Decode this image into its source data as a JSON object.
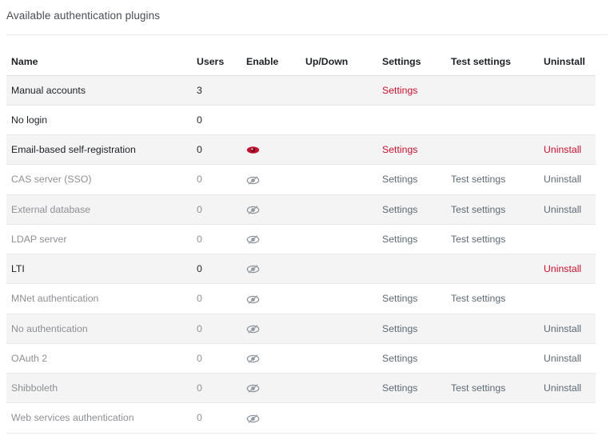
{
  "page": {
    "heading": "Available authentication plugins"
  },
  "table": {
    "columns": [
      {
        "key": "name",
        "label": "Name"
      },
      {
        "key": "users",
        "label": "Users"
      },
      {
        "key": "enable",
        "label": "Enable"
      },
      {
        "key": "updown",
        "label": "Up/Down"
      },
      {
        "key": "settings",
        "label": "Settings"
      },
      {
        "key": "test",
        "label": "Test settings"
      },
      {
        "key": "uninstall",
        "label": "Uninstall"
      }
    ],
    "labels": {
      "settings": "Settings",
      "test_settings": "Test settings",
      "uninstall": "Uninstall"
    },
    "icons": {
      "enabled": "eye-visible-icon",
      "disabled": "eye-slash-hidden-icon"
    },
    "colors": {
      "link_enabled": "#c4122f",
      "link_disabled": "#5d6a74",
      "text_enabled": "#1d2125",
      "text_disabled": "#8e9093",
      "row_shade": "#f4f4f5",
      "row_plain": "#ffffff",
      "eye_enabled": "#c4122f",
      "eye_disabled": "#8a9199"
    },
    "rows": [
      {
        "name": "Manual accounts",
        "users": "3",
        "enabled": true,
        "dim": false,
        "eye": "none",
        "updown": "",
        "settings": "Settings",
        "test": "",
        "uninstall": ""
      },
      {
        "name": "No login",
        "users": "0",
        "enabled": true,
        "dim": false,
        "eye": "none",
        "updown": "",
        "settings": "",
        "test": "",
        "uninstall": ""
      },
      {
        "name": "Email-based self-registration",
        "users": "0",
        "enabled": true,
        "dim": false,
        "eye": "visible",
        "updown": "",
        "settings": "Settings",
        "test": "",
        "uninstall": "Uninstall"
      },
      {
        "name": "CAS server (SSO)",
        "users": "0",
        "enabled": false,
        "dim": true,
        "eye": "hidden",
        "updown": "",
        "settings": "Settings",
        "test": "Test settings",
        "uninstall": "Uninstall"
      },
      {
        "name": "External database",
        "users": "0",
        "enabled": false,
        "dim": true,
        "eye": "hidden",
        "updown": "",
        "settings": "Settings",
        "test": "Test settings",
        "uninstall": "Uninstall"
      },
      {
        "name": "LDAP server",
        "users": "0",
        "enabled": false,
        "dim": true,
        "eye": "hidden",
        "updown": "",
        "settings": "Settings",
        "test": "Test settings",
        "uninstall": ""
      },
      {
        "name": "LTI",
        "users": "0",
        "enabled": false,
        "dim": false,
        "eye": "hidden",
        "updown": "",
        "settings": "",
        "test": "",
        "uninstall": "Uninstall"
      },
      {
        "name": "MNet authentication",
        "users": "0",
        "enabled": false,
        "dim": true,
        "eye": "hidden",
        "updown": "",
        "settings": "Settings",
        "test": "Test settings",
        "uninstall": ""
      },
      {
        "name": "No authentication",
        "users": "0",
        "enabled": false,
        "dim": true,
        "eye": "hidden",
        "updown": "",
        "settings": "Settings",
        "test": "",
        "uninstall": "Uninstall"
      },
      {
        "name": "OAuth 2",
        "users": "0",
        "enabled": false,
        "dim": true,
        "eye": "hidden",
        "updown": "",
        "settings": "Settings",
        "test": "",
        "uninstall": "Uninstall"
      },
      {
        "name": "Shibboleth",
        "users": "0",
        "enabled": false,
        "dim": true,
        "eye": "hidden",
        "updown": "",
        "settings": "Settings",
        "test": "Test settings",
        "uninstall": "Uninstall"
      },
      {
        "name": "Web services authentication",
        "users": "0",
        "enabled": false,
        "dim": true,
        "eye": "hidden",
        "updown": "",
        "settings": "",
        "test": "",
        "uninstall": ""
      }
    ]
  }
}
